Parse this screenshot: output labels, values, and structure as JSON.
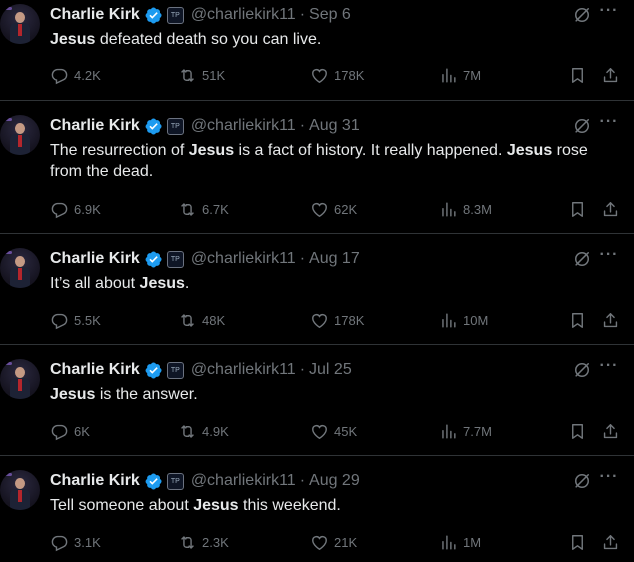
{
  "icons": {
    "verified": "verified-badge-icon",
    "affiliate": "affiliate-badge-icon",
    "grok": "grok-icon",
    "more": "more-icon",
    "reply": "reply-icon",
    "retweet": "retweet-icon",
    "like": "like-icon",
    "views": "views-icon",
    "bookmark": "bookmark-icon",
    "share": "share-icon"
  },
  "colors": {
    "background": "#000000",
    "text": "#e7e9ea",
    "muted": "#71767b",
    "verified": "#1d9bf0",
    "divider": "#2f3336"
  },
  "more_glyph": "···",
  "tweets": [
    {
      "author": "Charlie Kirk",
      "handle": "@charliekirk11",
      "separator": "·",
      "date": "Sep 6",
      "text_parts": [
        {
          "t": "Jesus",
          "b": true
        },
        {
          "t": " defeated death so you can live.",
          "b": false
        }
      ],
      "stats": {
        "replies": "4.2K",
        "retweets": "51K",
        "likes": "178K",
        "views": "7M"
      }
    },
    {
      "author": "Charlie Kirk",
      "handle": "@charliekirk11",
      "separator": "·",
      "date": "Aug 31",
      "text_parts": [
        {
          "t": "The resurrection of ",
          "b": false
        },
        {
          "t": "Jesus",
          "b": true
        },
        {
          "t": " is a fact of history. It really happened. ",
          "b": false
        },
        {
          "t": "Jesus",
          "b": true
        },
        {
          "t": " rose from the dead.",
          "b": false
        }
      ],
      "stats": {
        "replies": "6.9K",
        "retweets": "6.7K",
        "likes": "62K",
        "views": "8.3M"
      }
    },
    {
      "author": "Charlie Kirk",
      "handle": "@charliekirk11",
      "separator": "·",
      "date": "Aug 17",
      "text_parts": [
        {
          "t": "It’s all about ",
          "b": false
        },
        {
          "t": "Jesus",
          "b": true
        },
        {
          "t": ".",
          "b": false
        }
      ],
      "stats": {
        "replies": "5.5K",
        "retweets": "48K",
        "likes": "178K",
        "views": "10M"
      }
    },
    {
      "author": "Charlie Kirk",
      "handle": "@charliekirk11",
      "separator": "·",
      "date": "Jul 25",
      "text_parts": [
        {
          "t": "Jesus",
          "b": true
        },
        {
          "t": " is the answer.",
          "b": false
        }
      ],
      "stats": {
        "replies": "6K",
        "retweets": "4.9K",
        "likes": "45K",
        "views": "7.7M"
      }
    },
    {
      "author": "Charlie Kirk",
      "handle": "@charliekirk11",
      "separator": "·",
      "date": "Aug 29",
      "text_parts": [
        {
          "t": "Tell someone about ",
          "b": false
        },
        {
          "t": "Jesus",
          "b": true
        },
        {
          "t": " this weekend.",
          "b": false
        }
      ],
      "stats": {
        "replies": "3.1K",
        "retweets": "2.3K",
        "likes": "21K",
        "views": "1M"
      }
    }
  ]
}
